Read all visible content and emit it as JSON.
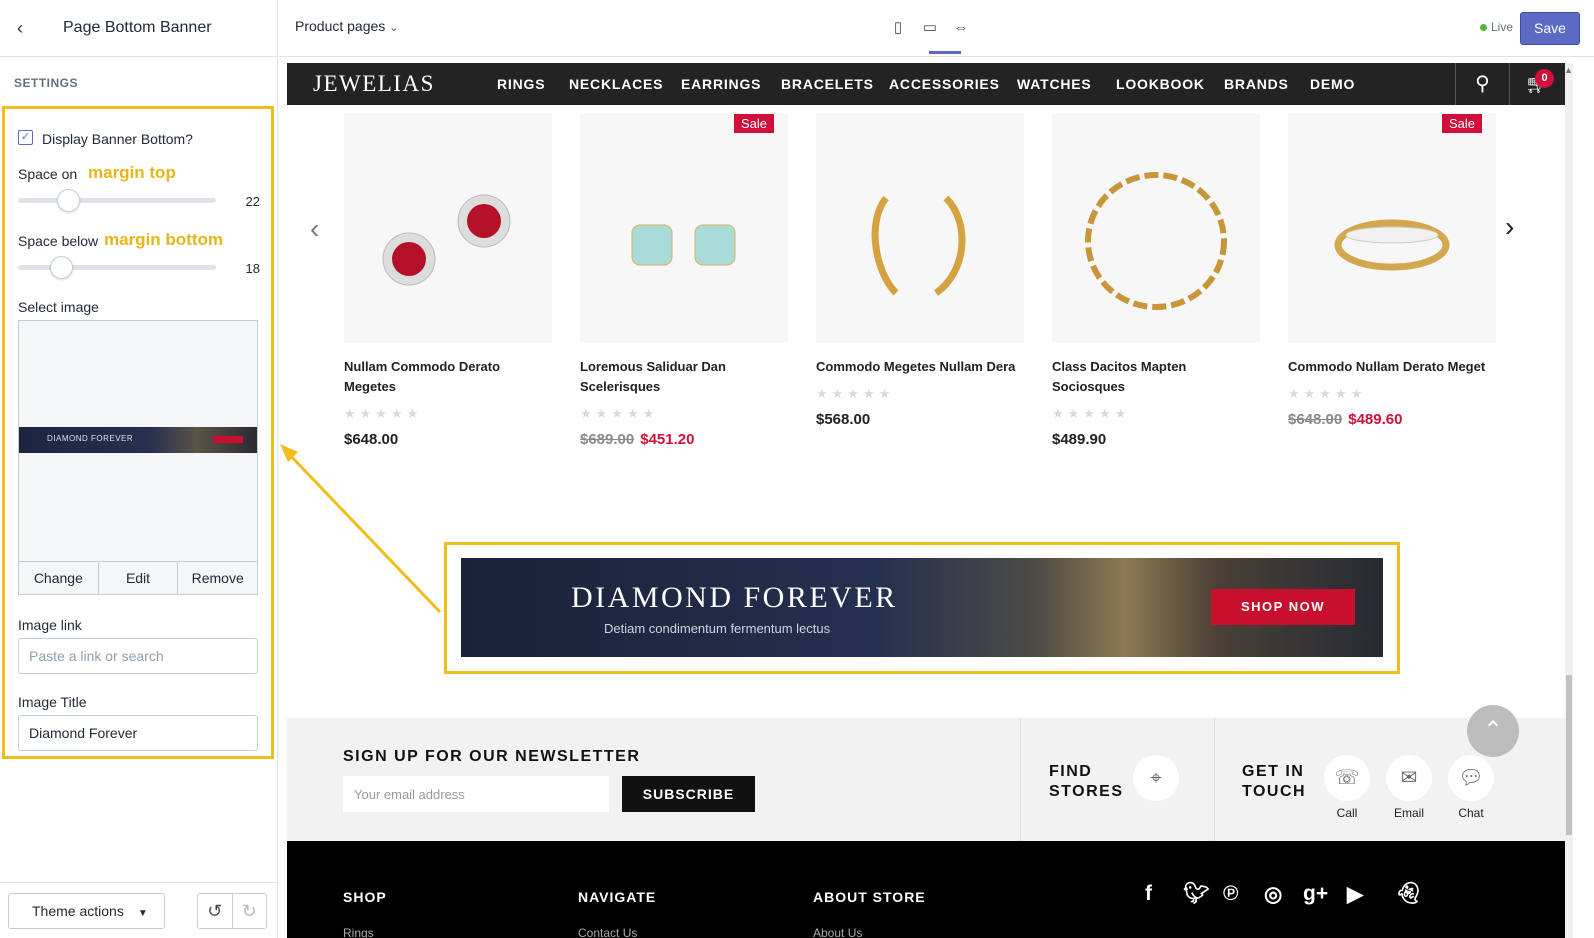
{
  "sidebar": {
    "title": "Page Bottom Banner",
    "section_label": "SETTINGS",
    "display_banner_label": "Display Banner Bottom?",
    "space_on_label": "Space on",
    "space_on_note": "margin top",
    "space_on_value": "22",
    "space_below_label": "Space below",
    "space_below_note": "margin bottom",
    "space_below_value": "18",
    "select_image_label": "Select image",
    "thumb_text": "DIAMOND FOREVER",
    "change_label": "Change",
    "edit_label": "Edit",
    "remove_label": "Remove",
    "image_link_label": "Image link",
    "image_link_placeholder": "Paste a link or search",
    "image_title_label": "Image Title",
    "image_title_value": "Diamond Forever",
    "theme_actions_label": "Theme actions"
  },
  "topbar": {
    "page_select": "Product pages",
    "live_label": "Live",
    "save_label": "Save"
  },
  "store": {
    "logo": "JEWELIAS",
    "nav": [
      "RINGS",
      "NECKLACES",
      "EARRINGS",
      "BRACELETS",
      "ACCESSORIES",
      "WATCHES",
      "LOOKBOOK",
      "BRANDS",
      "DEMO"
    ],
    "cart_count": "0",
    "products": [
      {
        "name": "Nullam Commodo Derato Megetes",
        "price": "$648.00",
        "old_price": "",
        "sale_price": "",
        "sale": false
      },
      {
        "name": "Loremous Saliduar Dan Scelerisques",
        "price": "",
        "old_price": "$689.00",
        "sale_price": "$451.20",
        "sale": true
      },
      {
        "name": "Commodo Megetes Nullam Dera",
        "price": "$568.00",
        "old_price": "",
        "sale_price": "",
        "sale": false
      },
      {
        "name": "Class Dacitos Mapten Sociosques",
        "price": "$489.90",
        "old_price": "",
        "sale_price": "",
        "sale": false
      },
      {
        "name": "Commodo Nullam Derato Meget",
        "price": "",
        "old_price": "$648.00",
        "sale_price": "$489.60",
        "sale": true
      }
    ],
    "sale_badge": "Sale",
    "banner": {
      "title": "DIAMOND FOREVER",
      "subtitle": "Detiam condimentum fermentum lectus",
      "button": "SHOP NOW"
    },
    "newsletter": {
      "title": "SIGN UP FOR OUR NEWSLETTER",
      "placeholder": "Your email address",
      "button": "SUBSCRIBE",
      "find_stores": "FIND STORES",
      "get_in_touch": "GET IN TOUCH",
      "contacts": [
        "Call",
        "Email",
        "Chat"
      ]
    },
    "footer": {
      "headings": [
        "SHOP",
        "NAVIGATE",
        "ABOUT STORE"
      ],
      "links": [
        "Rings",
        "Contact Us",
        "About Us"
      ]
    }
  },
  "colors": {
    "accent": "#5c6ac4",
    "highlight": "#efbe1c",
    "sale": "#d0103a"
  }
}
